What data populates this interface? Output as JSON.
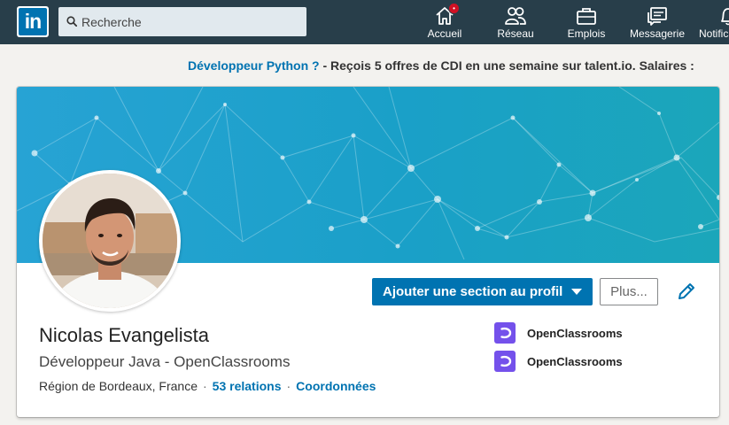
{
  "header": {
    "logo_text": "in",
    "search": {
      "placeholder": "Recherche",
      "value": ""
    },
    "nav": [
      {
        "label": "Accueil",
        "icon": "home-icon",
        "badge": "•"
      },
      {
        "label": "Réseau",
        "icon": "network-icon"
      },
      {
        "label": "Emplois",
        "icon": "briefcase-icon"
      },
      {
        "label": "Messagerie",
        "icon": "messaging-icon"
      },
      {
        "label": "Notifica",
        "icon": "bell-icon"
      }
    ]
  },
  "promo": {
    "link_text": "Développeur Python ?",
    "text": " - Reçois 5 offres de CDI en une semaine sur talent.io. Salaires :"
  },
  "profile": {
    "add_section_label": "Ajouter une section au profil",
    "more_label": "Plus...",
    "name": "Nicolas Evangelista",
    "headline": "Développeur Java - OpenClassrooms",
    "location": "Région de Bordeaux, France",
    "separator": "·",
    "connections": "53 relations",
    "contact": "Coordonnées",
    "organizations": [
      {
        "name": "OpenClassrooms"
      },
      {
        "name": "OpenClassrooms"
      }
    ]
  },
  "colors": {
    "nav_bg": "#283e4a",
    "brand_blue": "#0073b1",
    "banner": "#1aa0c8",
    "openclassrooms": "#7451eb"
  }
}
